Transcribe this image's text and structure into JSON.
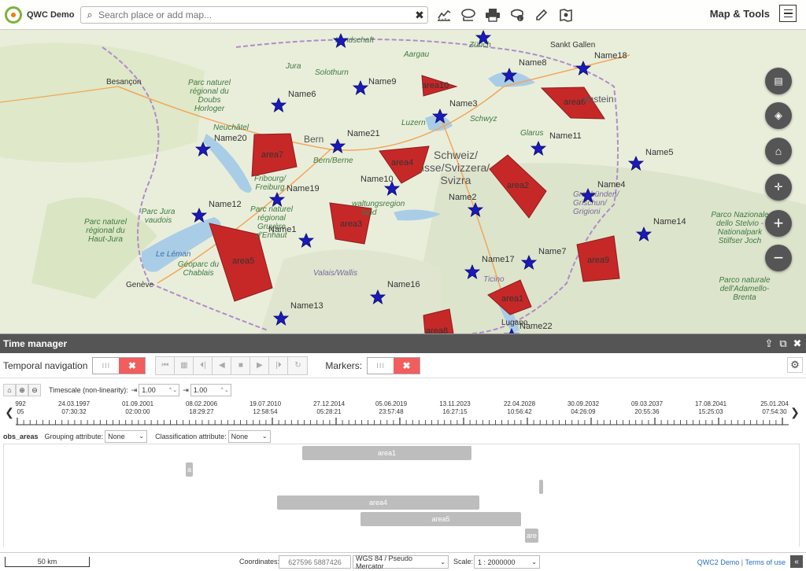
{
  "app": {
    "title": "QWC Demo"
  },
  "search": {
    "placeholder": "Search place or add map..."
  },
  "toolbar": {
    "buttons": [
      {
        "name": "measure-icon"
      },
      {
        "name": "redline-icon"
      },
      {
        "name": "print-icon"
      },
      {
        "name": "identify-icon"
      },
      {
        "name": "edit-icon"
      },
      {
        "name": "compare-icon"
      }
    ],
    "map_tools_label": "Map & Tools"
  },
  "map": {
    "features": [
      {
        "label": "area10"
      },
      {
        "label": "area6"
      },
      {
        "label": "area7"
      },
      {
        "label": "area4"
      },
      {
        "label": "area2"
      },
      {
        "label": "area3"
      },
      {
        "label": "area5"
      },
      {
        "label": "area9"
      },
      {
        "label": "area1"
      },
      {
        "label": "area8"
      }
    ],
    "markers": [
      {
        "label": "Name9"
      },
      {
        "label": "Name8"
      },
      {
        "label": "Name18"
      },
      {
        "label": "Name6"
      },
      {
        "label": "Name3"
      },
      {
        "label": "Name20"
      },
      {
        "label": "Name21"
      },
      {
        "label": "Name11"
      },
      {
        "label": "Name5"
      },
      {
        "label": "Name10"
      },
      {
        "label": "Name19"
      },
      {
        "label": "Name4"
      },
      {
        "label": "Name12"
      },
      {
        "label": "Name2"
      },
      {
        "label": "Name1"
      },
      {
        "label": "Name14"
      },
      {
        "label": "Name7"
      },
      {
        "label": "Name17"
      },
      {
        "label": "Name16"
      },
      {
        "label": "Name13"
      },
      {
        "label": "Name22"
      }
    ],
    "places": [
      "Landschaft",
      "Aargau",
      "Zürich",
      "Sankt Gallen",
      "Jura",
      "Solothurn",
      "Besançon",
      "Parc naturel régional du Doubs Horloger",
      "Luzern",
      "Schwyz",
      "enstein",
      "Neuchâtel",
      "Bern",
      "Bern/Berne",
      "Glarus",
      "Fribourg/ Freiburg",
      "Schweiz/ isse/Svizzera/ Svizra",
      "Parc Jura vaudois",
      "Parc naturel régional du Haut-Jura",
      "Parc naturel régional Gruyère d'Enhaut",
      "waltungsregion land",
      "Graubünden/ Grischun/ Grigioni",
      "Parco Nazionale dello Stelvio - Nationalpark Stilfser Joch",
      "Le Léman",
      "Géoparc du Chablais",
      "Valais/Wallis",
      "Ticino",
      "Genève",
      "Lugano",
      "Parco naturale dell'Adamello- Brenta"
    ]
  },
  "time_manager": {
    "title": "Time manager",
    "temporal_navigation_label": "Temporal navigation",
    "markers_label": "Markers:",
    "timescale_label": "Timescale (non-linearity):",
    "timescale_value_1": "1.00",
    "timescale_value_2": "1.00",
    "timeline_ticks": [
      {
        "date": "992",
        "time": "05"
      },
      {
        "date": "24.03.1997",
        "time": "07:30:32"
      },
      {
        "date": "01.09.2001",
        "time": "02:00:00"
      },
      {
        "date": "08.02.2006",
        "time": "18:29:27"
      },
      {
        "date": "19.07.2010",
        "time": "12:58:54"
      },
      {
        "date": "27.12.2014",
        "time": "05:28:21"
      },
      {
        "date": "05.06.2019",
        "time": "23:57:48"
      },
      {
        "date": "13.11.2023",
        "time": "16:27:15"
      },
      {
        "date": "22.04.2028",
        "time": "10:56:42"
      },
      {
        "date": "30.09.2032",
        "time": "04:26:09"
      },
      {
        "date": "09.03.2037",
        "time": "20:55:36"
      },
      {
        "date": "17.08.2041",
        "time": "15:25:03"
      },
      {
        "date": "25.01.204",
        "time": "07:54:30"
      }
    ],
    "layer_name": "obs_areas",
    "grouping_label": "Grouping attribute:",
    "grouping_value": "None",
    "classification_label": "Classification attribute:",
    "classification_value": "None",
    "bars": [
      {
        "label": "area1"
      },
      {
        "label": "a"
      },
      {
        "label": ""
      },
      {
        "label": "area4"
      },
      {
        "label": "area5"
      },
      {
        "label": "are"
      }
    ]
  },
  "status": {
    "scale_bar": "50 km",
    "coordinates_label": "Coordinates:",
    "coordinates_value": "627596 5887426",
    "crs": "WGS 84 / Pseudo Mercator",
    "scale_label": "Scale:",
    "scale_value": "1 : 2000000",
    "credit_1": "QWC2 Demo",
    "credit_sep": "|",
    "credit_2": "Terms of use"
  }
}
